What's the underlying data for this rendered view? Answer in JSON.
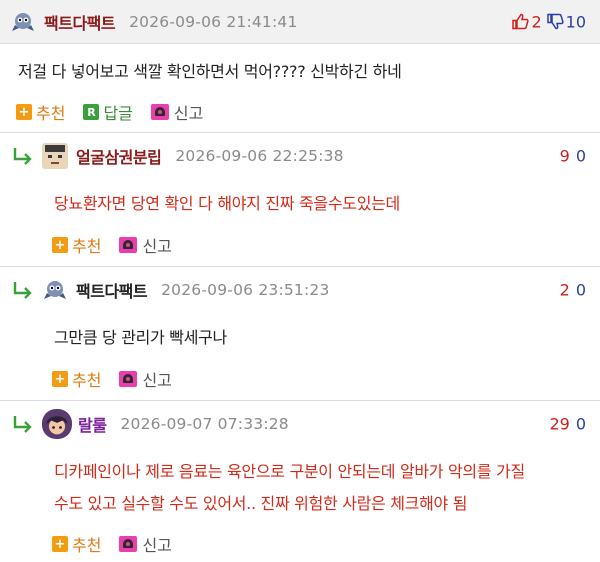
{
  "comments": [
    {
      "nickname": "팩트다팩트",
      "date": "2026-09-06 21:41:41",
      "text": "저걸 다 넣어보고 색깔 확인하면서 먹어???? 신박하긴 하네",
      "up": "2",
      "down": "10",
      "actions": {
        "recommend": "추천",
        "reply": "답글",
        "report": "신고"
      }
    },
    {
      "nickname": "얼굴삼권분립",
      "date": "2026-09-06 22:25:38",
      "text": "당뇨환자면 당연 확인 다 해야지 진짜 죽을수도있는데",
      "up": "9",
      "down": "0",
      "actions": {
        "recommend": "추천",
        "report": "신고"
      }
    },
    {
      "nickname": "팩트다팩트",
      "date": "2026-09-06 23:51:23",
      "text": "그만큼 당 관리가 빡세구나",
      "up": "2",
      "down": "0",
      "actions": {
        "recommend": "추천",
        "report": "신고"
      }
    },
    {
      "nickname": "랄룰",
      "date": "2026-09-07 07:33:28",
      "text_line1": "디카페인이나 제로 음료는 육안으로 구분이 안되는데 알바가 악의를 가질",
      "text_line2": "수도 있고 실수할 수도 있어서.. 진짜 위험한 사람은 체크해야 됨",
      "up": "29",
      "down": "0",
      "actions": {
        "recommend": "추천",
        "report": "신고"
      }
    }
  ],
  "colors": {
    "up": "#d0201c",
    "down": "#2a3fa6",
    "reply_text": "#d42a1a",
    "recommend": "#e27a10"
  },
  "icons": [
    "ghost-avatar-icon",
    "thumbs-up-icon",
    "thumbs-down-icon",
    "plus-icon",
    "reply-r-icon",
    "siren-icon",
    "reply-arrow-icon"
  ]
}
